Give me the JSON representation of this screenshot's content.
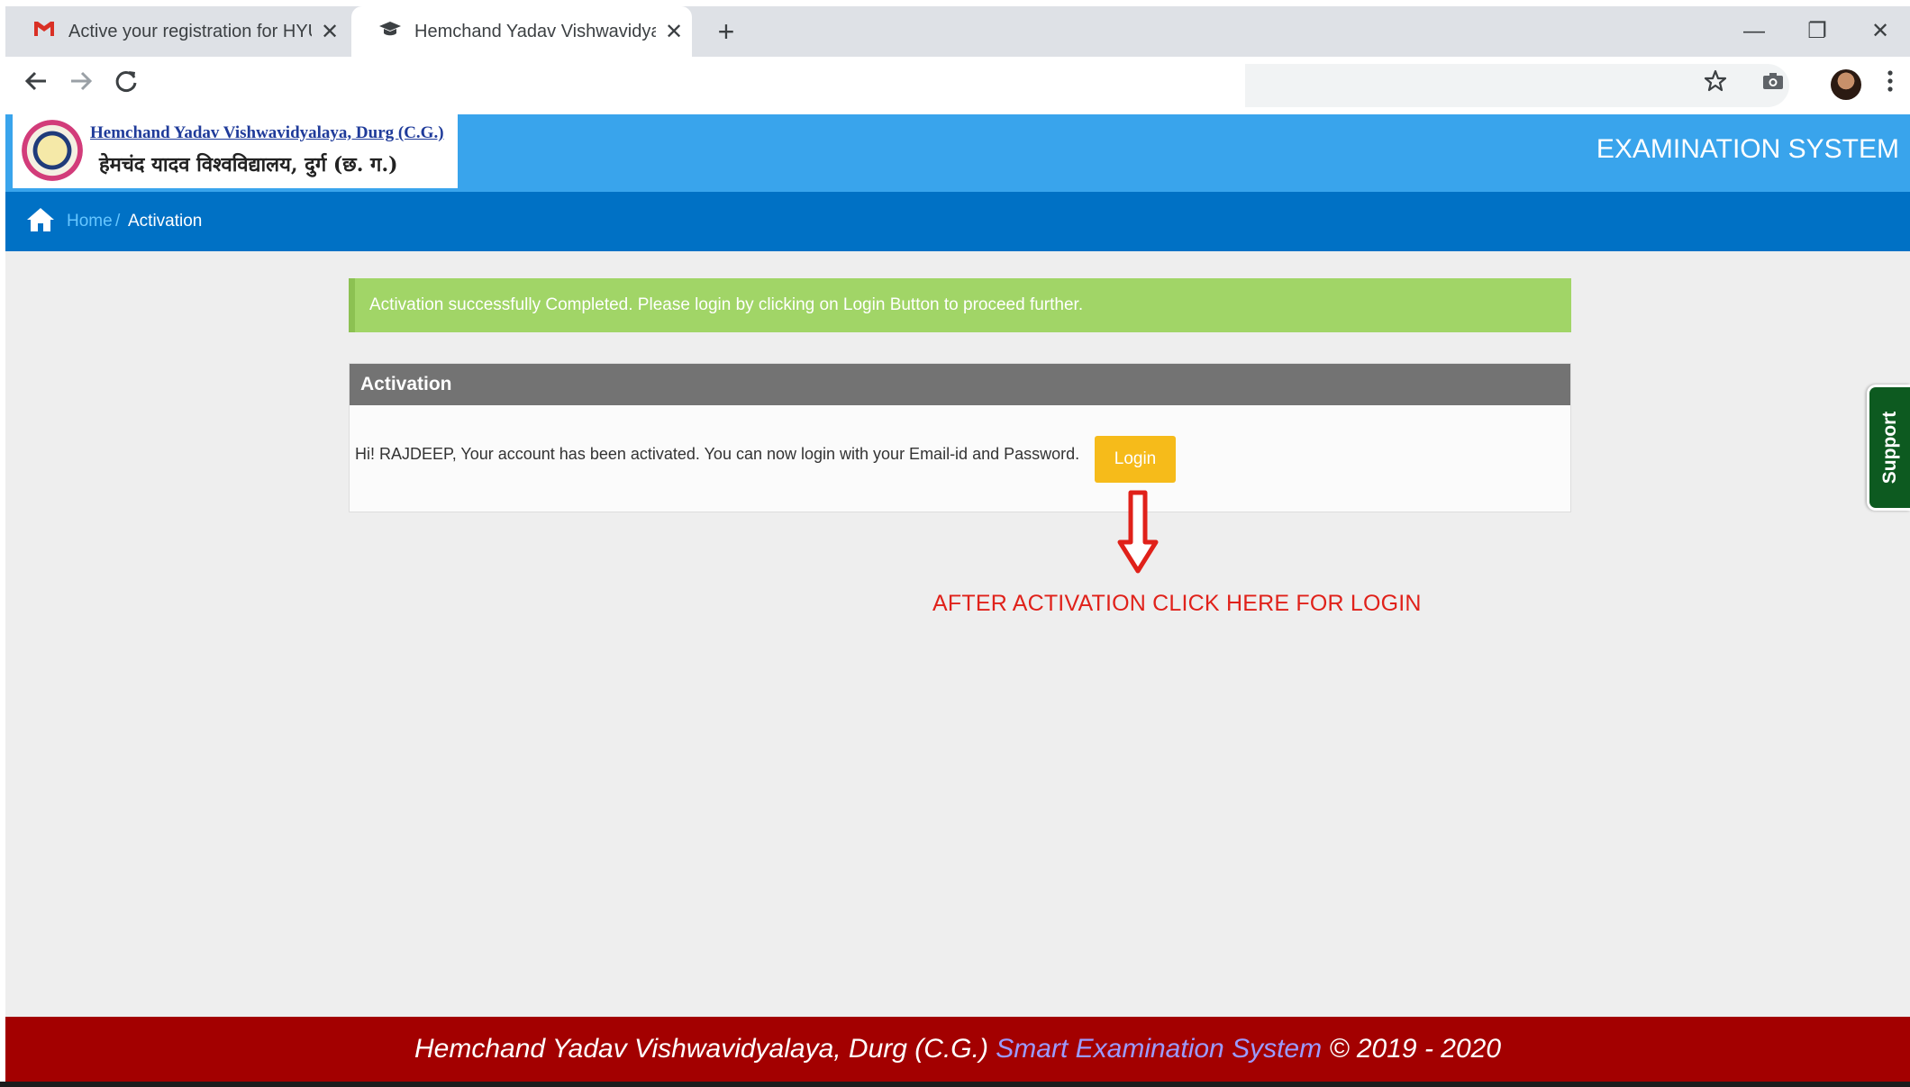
{
  "browser": {
    "tabs": [
      {
        "icon": "gmail-icon",
        "title": "Active your registration for HYU ("
      },
      {
        "icon": "graduation-cap-icon",
        "title": "Hemchand Yadav Vishwavidyalay"
      }
    ],
    "new_tab_label": "+",
    "window_controls": {
      "minimize": "—",
      "restore": "❐",
      "close": "✕"
    }
  },
  "header": {
    "logo_english": "Hemchand Yadav Vishwavidyalaya, Durg (C.G.)",
    "logo_hindi": "हेमचंद यादव विश्वविद्यालय, दुर्ग (छ. ग.)",
    "system_title": "EXAMINATION SYSTEM"
  },
  "breadcrumb": {
    "home": "Home",
    "separator": "/",
    "current": "Activation"
  },
  "alert": {
    "message": "Activation successfully Completed. Please login by clicking on Login Button to proceed further."
  },
  "panel": {
    "title": "Activation",
    "text": "Hi! RAJDEEP, Your account has been activated. You can now login with your Email-id and Password.",
    "login_button": "Login"
  },
  "annotation": {
    "text": "AFTER ACTIVATION CLICK HERE FOR LOGIN"
  },
  "support": {
    "label": "Support"
  },
  "footer": {
    "university": "Hemchand Yadav Vishwavidyalaya, Durg (C.G.)",
    "system": "Smart Examination System",
    "copyright": "© 2019 - 2020"
  },
  "colors": {
    "header_blue": "#39a4ec",
    "breadcrumb_blue": "#0071c5",
    "alert_green": "#a1d567",
    "panel_heading_gray": "#737373",
    "login_yellow": "#f6bb1a",
    "annotation_red": "#e0211a",
    "support_green": "#0d5a20",
    "footer_red": "#a30000"
  }
}
